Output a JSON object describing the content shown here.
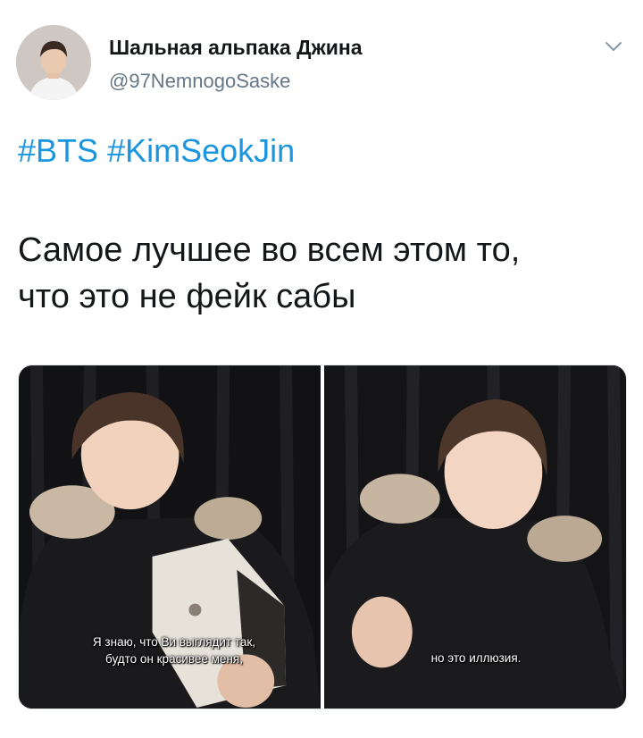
{
  "author": {
    "display_name": "Шальная альпака Джина",
    "handle": "@97NemnogoSaske"
  },
  "menu": {
    "icon": "chevron-down-icon"
  },
  "hashtags": [
    "#BTS",
    "#KimSeokJin"
  ],
  "text": {
    "line1": "Самое лучшее во всем этом то,",
    "line2": "что это не фейк сабы"
  },
  "media": [
    {
      "subtitle_line1": "Я знаю, что Ви выглядит так,",
      "subtitle_line2": "будто он красивее меня,"
    },
    {
      "subtitle_line1": "но это иллюзия."
    }
  ],
  "colors": {
    "link": "#1b95e0",
    "handle": "#657786",
    "text": "#14171a"
  }
}
